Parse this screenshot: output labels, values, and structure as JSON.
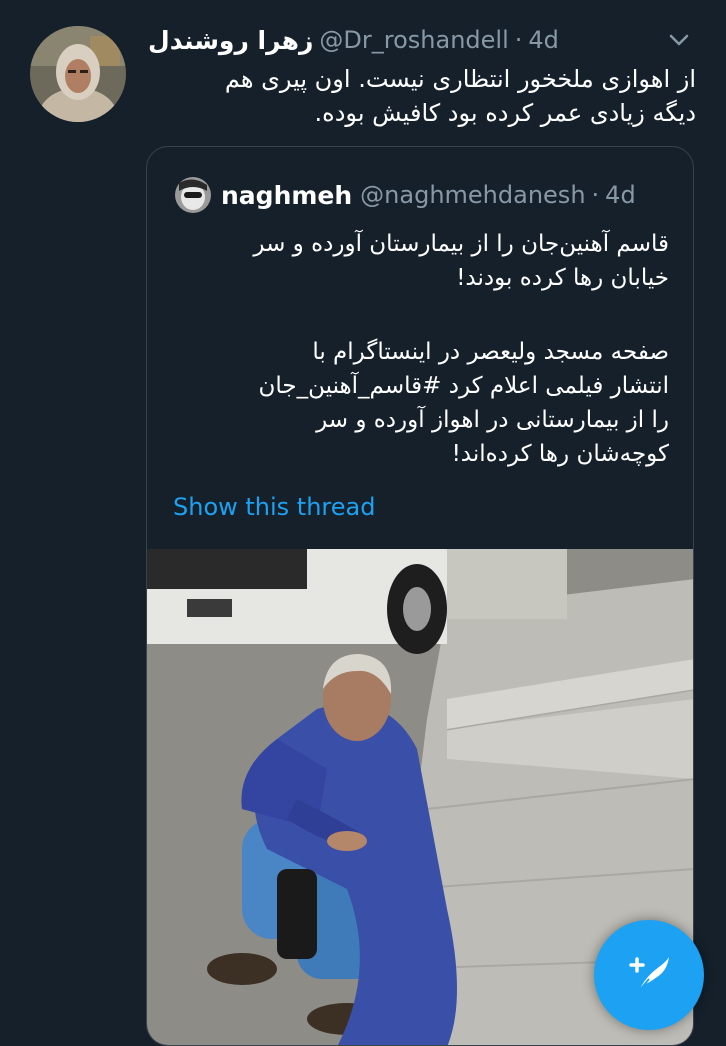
{
  "tweet": {
    "display_name": "زهرا روشندل",
    "handle": "@Dr_roshandell",
    "separator": "·",
    "time": "4d",
    "text_lines": [
      "از اهوازی ملخخور انتظاری نیست. اون پیری هم",
      "دیگه زیادی عمر کرده بود کافیش بوده."
    ]
  },
  "quoted": {
    "display_name": "naghmeh",
    "handle": "@naghmehdanesh",
    "separator": "·",
    "time": "4d",
    "paragraph1": [
      "قاسم آهنین‌جان را از بیمارستان آورده و سر",
      "خیابان رها کرده بودند!"
    ],
    "paragraph2": [
      "صفحه مسجد ولیعصر در اینستاگرام با",
      "انتشار فیلمی اعلام کرد #قاسم_آهنین_جان",
      "را از بیمارستانی در اهواز آورده و سر",
      "کوچه‌شان رها کرده‌اند!"
    ],
    "show_thread": "Show this thread"
  },
  "colors": {
    "background": "#15202b",
    "accent": "#1da1f2",
    "secondary_text": "#8899a6",
    "border": "#38444d"
  },
  "icons": {
    "caret": "chevron-down-icon",
    "compose": "compose-tweet-icon"
  }
}
